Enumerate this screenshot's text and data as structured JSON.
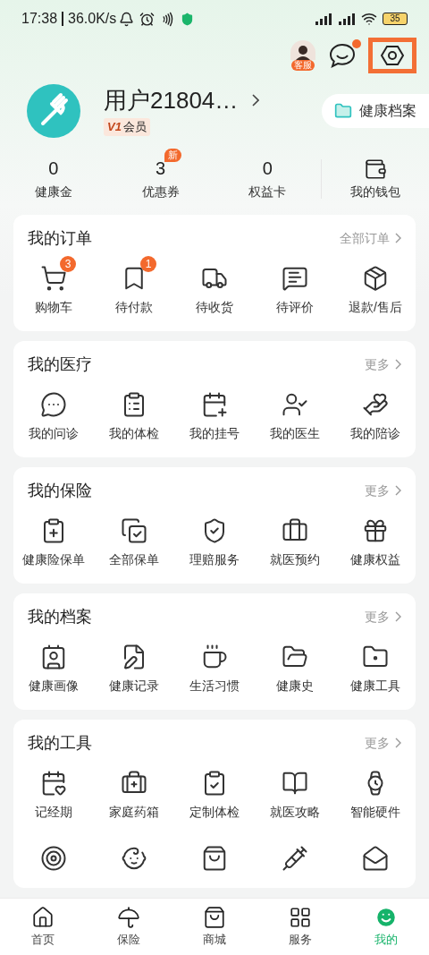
{
  "status_bar": {
    "time": "17:38",
    "speed": "36.0K/s",
    "battery": "35"
  },
  "header": {
    "support_label": "客服"
  },
  "profile": {
    "name": "用户21804…",
    "level": "V1",
    "member": "会员",
    "health_record": "健康档案"
  },
  "stats": [
    {
      "value": "0",
      "label": "健康金"
    },
    {
      "value": "3",
      "label": "优惠券",
      "badge": "新"
    },
    {
      "value": "0",
      "label": "权益卡"
    }
  ],
  "wallet": {
    "label": "我的钱包"
  },
  "sections": [
    {
      "title": "我的订单",
      "link": "全部订单",
      "items": [
        {
          "kind": "labeled",
          "label": "购物车",
          "badge": "3"
        },
        {
          "kind": "labeled",
          "label": "待付款",
          "badge": "1"
        },
        {
          "kind": "labeled",
          "label": "待收货"
        },
        {
          "kind": "labeled",
          "label": "待评价"
        },
        {
          "kind": "labeled",
          "label": "退款/售后"
        }
      ]
    },
    {
      "title": "我的医疗",
      "link": "更多",
      "items": [
        {
          "kind": "labeled",
          "label": "我的问诊"
        },
        {
          "kind": "labeled",
          "label": "我的体检"
        },
        {
          "kind": "labeled",
          "label": "我的挂号"
        },
        {
          "kind": "labeled",
          "label": "我的医生"
        },
        {
          "kind": "labeled",
          "label": "我的陪诊"
        }
      ]
    },
    {
      "title": "我的保险",
      "link": "更多",
      "items": [
        {
          "kind": "labeled",
          "label": "健康险保单"
        },
        {
          "kind": "labeled",
          "label": "全部保单"
        },
        {
          "kind": "labeled",
          "label": "理赔服务"
        },
        {
          "kind": "labeled",
          "label": "就医预约"
        },
        {
          "kind": "labeled",
          "label": "健康权益"
        }
      ]
    },
    {
      "title": "我的档案",
      "link": "更多",
      "items": [
        {
          "kind": "labeled",
          "label": "健康画像"
        },
        {
          "kind": "labeled",
          "label": "健康记录"
        },
        {
          "kind": "labeled",
          "label": "生活习惯"
        },
        {
          "kind": "labeled",
          "label": "健康史"
        },
        {
          "kind": "labeled",
          "label": "健康工具"
        }
      ]
    },
    {
      "title": "我的工具",
      "link": "更多",
      "items": [
        {
          "kind": "labeled",
          "label": "记经期"
        },
        {
          "kind": "labeled",
          "label": "家庭药箱"
        },
        {
          "kind": "labeled",
          "label": "定制体检"
        },
        {
          "kind": "labeled",
          "label": "就医攻略"
        },
        {
          "kind": "labeled",
          "label": "智能硬件"
        },
        {
          "kind": "icon"
        },
        {
          "kind": "icon"
        },
        {
          "kind": "icon"
        },
        {
          "kind": "icon"
        },
        {
          "kind": "icon"
        }
      ]
    }
  ],
  "tabs": [
    {
      "label": "首页",
      "selected": false
    },
    {
      "label": "保险",
      "selected": false
    },
    {
      "label": "商城",
      "selected": false
    },
    {
      "label": "服务",
      "selected": false
    },
    {
      "label": "我的",
      "selected": true
    }
  ]
}
